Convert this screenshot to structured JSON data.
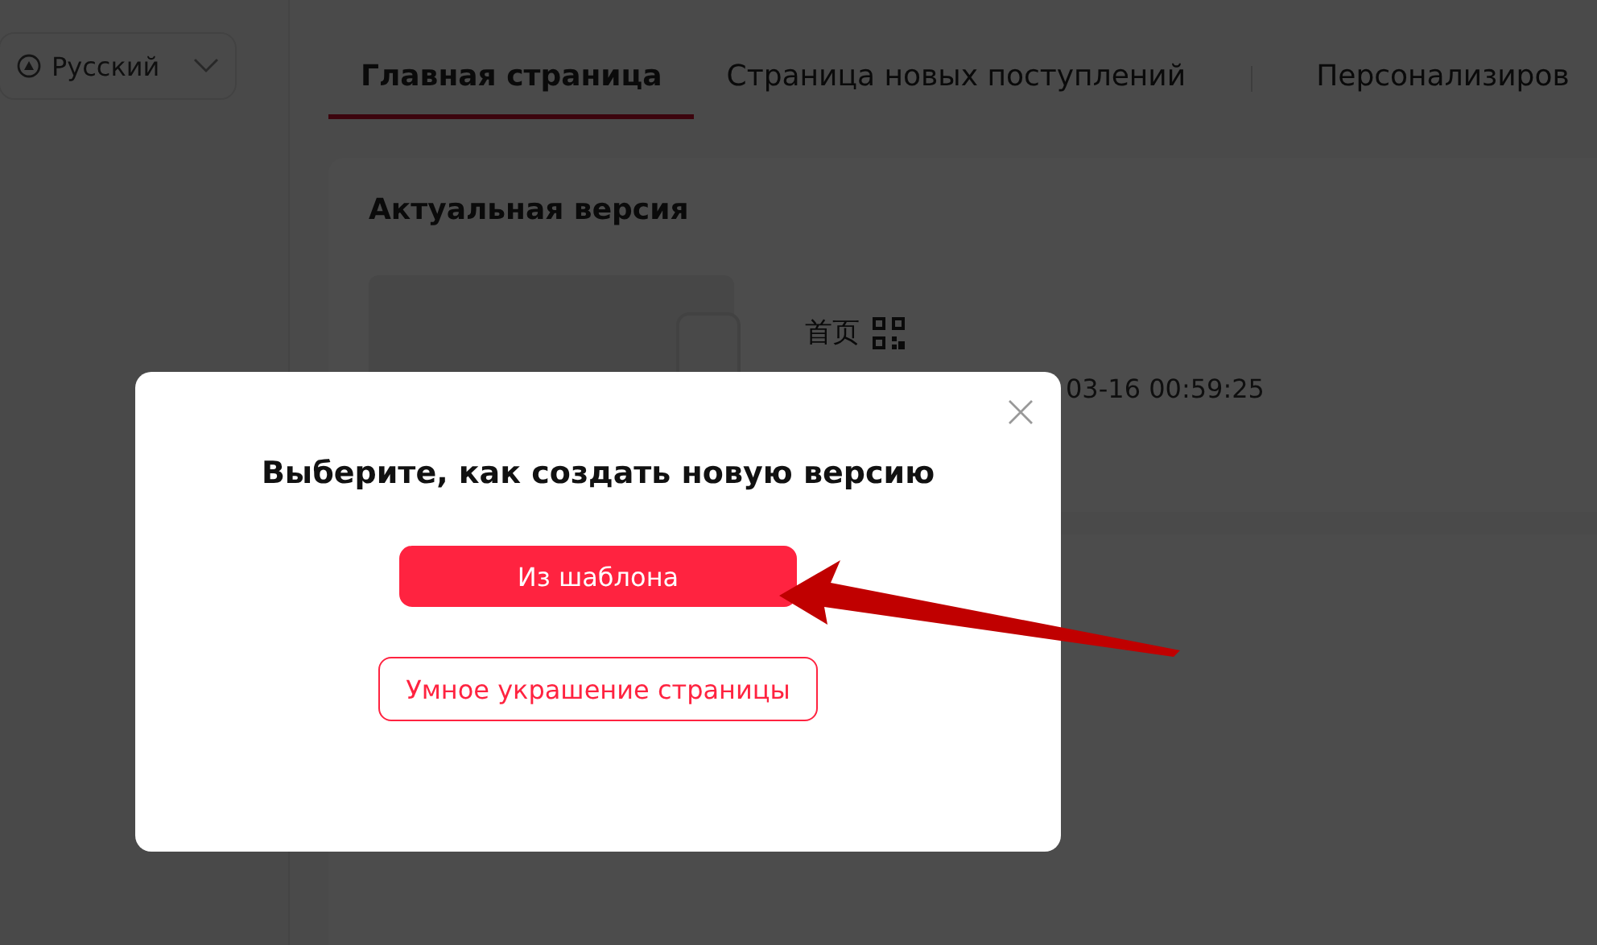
{
  "sidebar": {
    "language": {
      "label": "Русский"
    }
  },
  "tabs": [
    {
      "label": "Главная страница",
      "selected": true
    },
    {
      "label": "Страница новых поступлений",
      "selected": false
    },
    {
      "label": "Персонализиров",
      "selected": false
    }
  ],
  "card": {
    "title": "Актуальная версия",
    "page_name": "首页",
    "time": "03-16 00:59:25"
  },
  "dialog": {
    "title": "Выберите, как создать новую версию",
    "buttons": [
      {
        "label": "Из шаблона",
        "kind": "primary"
      },
      {
        "label": "Умное украшение страницы",
        "kind": "outline"
      }
    ]
  }
}
